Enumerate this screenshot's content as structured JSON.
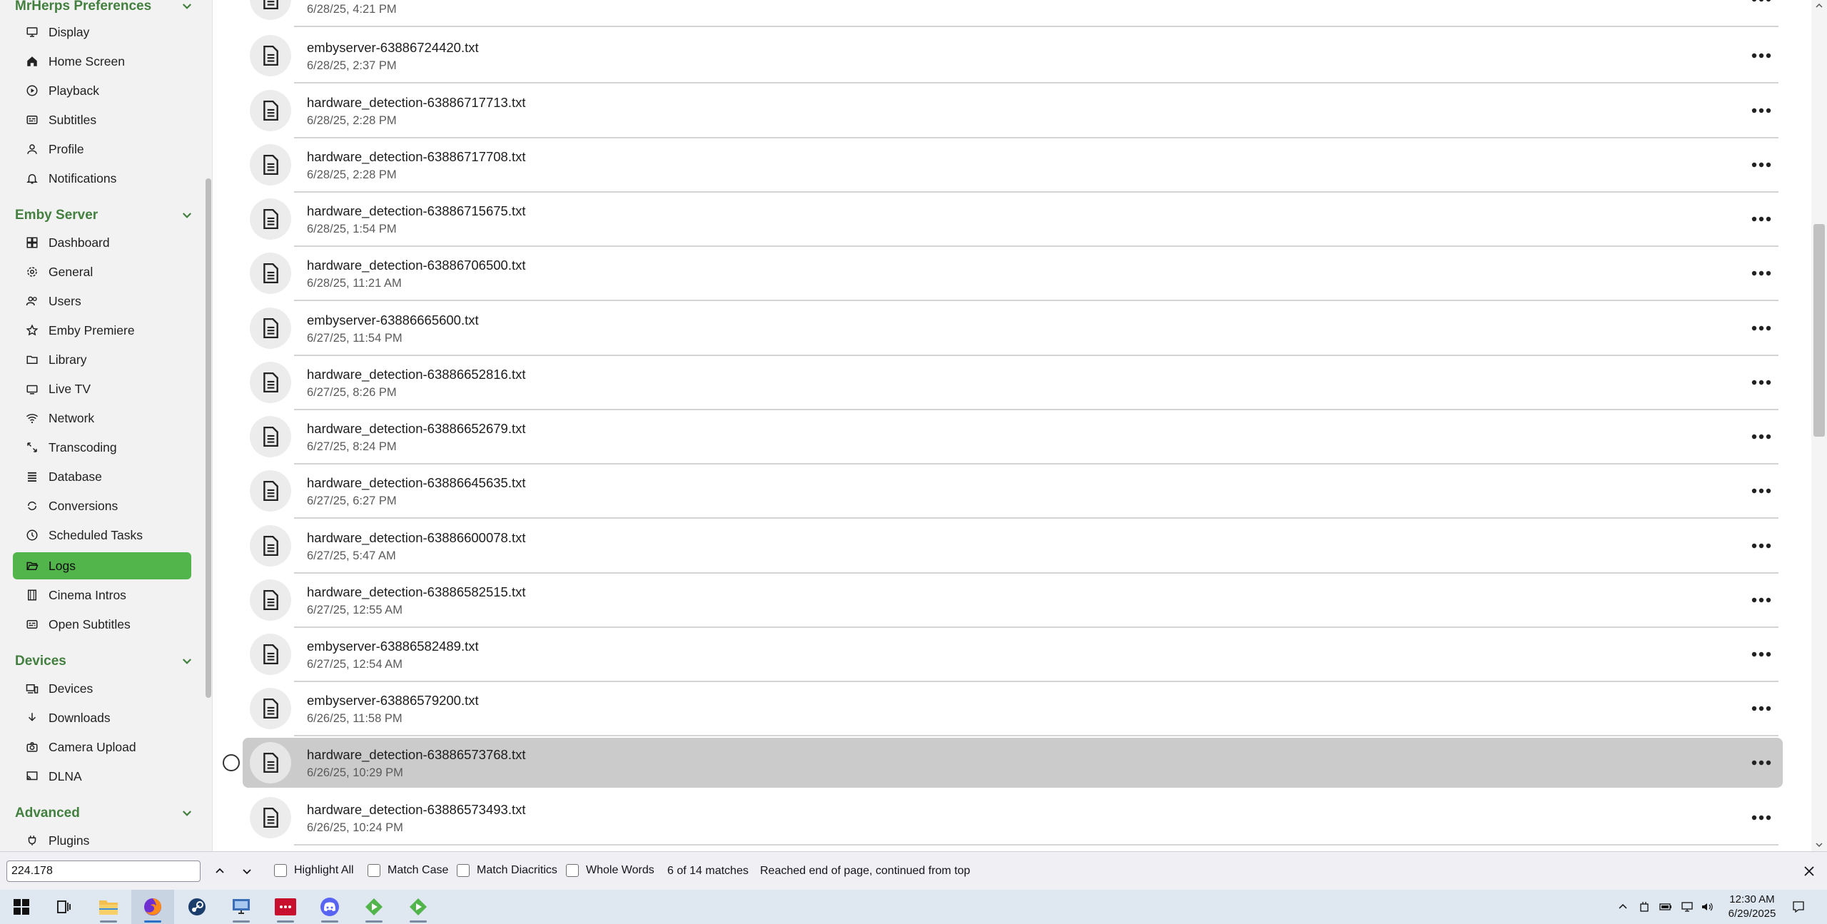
{
  "sidebar": {
    "sections": [
      {
        "title": "MrHerps Preferences",
        "items": [
          "Display",
          "Home Screen",
          "Playback",
          "Subtitles",
          "Profile",
          "Notifications"
        ]
      },
      {
        "title": "Emby Server",
        "items": [
          "Dashboard",
          "General",
          "Users",
          "Emby Premiere",
          "Library",
          "Live TV",
          "Network",
          "Transcoding",
          "Database",
          "Conversions",
          "Scheduled Tasks",
          "Logs",
          "Cinema Intros",
          "Open Subtitles"
        ]
      },
      {
        "title": "Devices",
        "items": [
          "Devices",
          "Downloads",
          "Camera Upload",
          "DLNA"
        ]
      },
      {
        "title": "Advanced",
        "items": [
          "Plugins"
        ]
      }
    ],
    "active_item": "Logs"
  },
  "logs": [
    {
      "name": "",
      "date": "6/28/25, 4:21 PM"
    },
    {
      "name": "embyserver-63886724420.txt",
      "date": "6/28/25, 2:37 PM"
    },
    {
      "name": "hardware_detection-63886717713.txt",
      "date": "6/28/25, 2:28 PM"
    },
    {
      "name": "hardware_detection-63886717708.txt",
      "date": "6/28/25, 2:28 PM"
    },
    {
      "name": "hardware_detection-63886715675.txt",
      "date": "6/28/25, 1:54 PM"
    },
    {
      "name": "hardware_detection-63886706500.txt",
      "date": "6/28/25, 11:21 AM"
    },
    {
      "name": "embyserver-63886665600.txt",
      "date": "6/27/25, 11:54 PM"
    },
    {
      "name": "hardware_detection-63886652816.txt",
      "date": "6/27/25, 8:26 PM"
    },
    {
      "name": "hardware_detection-63886652679.txt",
      "date": "6/27/25, 8:24 PM"
    },
    {
      "name": "hardware_detection-63886645635.txt",
      "date": "6/27/25, 6:27 PM"
    },
    {
      "name": "hardware_detection-63886600078.txt",
      "date": "6/27/25, 5:47 AM"
    },
    {
      "name": "hardware_detection-63886582515.txt",
      "date": "6/27/25, 12:55 AM"
    },
    {
      "name": "embyserver-63886582489.txt",
      "date": "6/27/25, 12:54 AM"
    },
    {
      "name": "embyserver-63886579200.txt",
      "date": "6/26/25, 11:58 PM"
    },
    {
      "name": "hardware_detection-63886573768.txt",
      "date": "6/26/25, 10:29 PM"
    },
    {
      "name": "hardware_detection-63886573493.txt",
      "date": "6/26/25, 10:24 PM"
    }
  ],
  "selected_log": "hardware_detection-63886573768.txt",
  "findbar": {
    "query": "224.178",
    "highlight_all": "Highlight All",
    "match_case": "Match Case",
    "match_diacritics": "Match Diacritics",
    "whole_words": "Whole Words",
    "match_count": "6 of 14 matches",
    "status": "Reached end of page, continued from top"
  },
  "taskbar": {
    "apps": [
      "start-icon",
      "task-view-icon",
      "file-explorer-icon",
      "firefox-icon",
      "steam-icon",
      "remote-desktop-icon",
      "dots-app-icon",
      "discord-icon",
      "media-player-icon",
      "media-player-2-icon"
    ],
    "time": "12:30 AM",
    "date": "6/29/2025"
  },
  "colors": {
    "accent": "#52b54b",
    "selected_row": "#cbcbcb",
    "sidebar_bg": "#f2f2f2"
  }
}
